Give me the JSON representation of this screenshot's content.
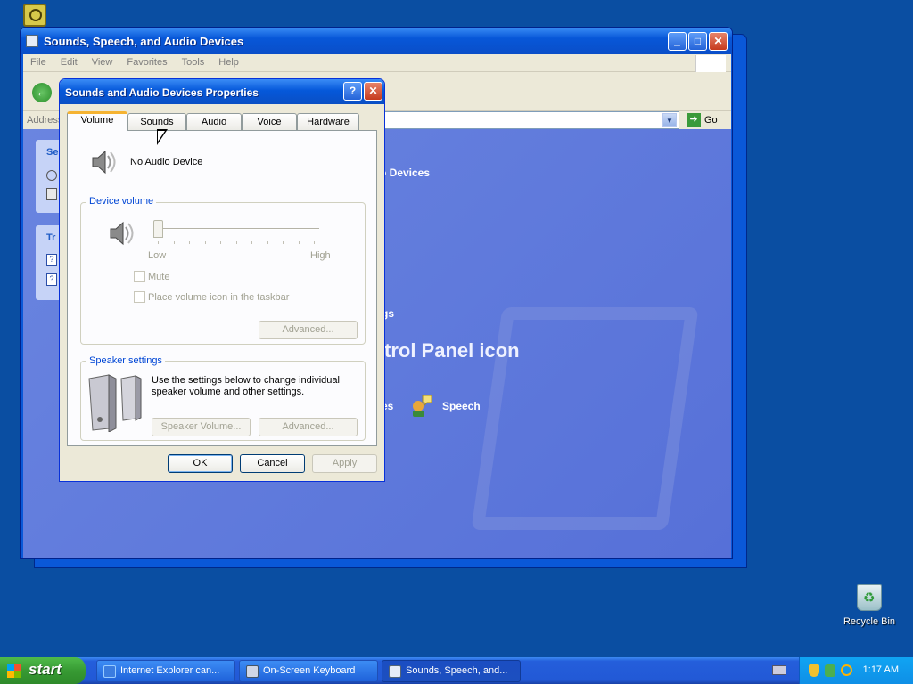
{
  "desktop": {
    "recycle_bin_label": "Recycle Bin"
  },
  "explorer": {
    "title": "Sounds, Speech, and Audio Devices",
    "menu": [
      "File",
      "Edit",
      "View",
      "Favorites",
      "Tools",
      "Help"
    ],
    "address_label": "Address",
    "go_label": "Go",
    "content_heading_partial": "o Devices",
    "pick_text_partial": "trol Panel icon",
    "partial_link_1": "gs",
    "partial_link_2": "es",
    "speech_label": "Speech",
    "task_pane_1_partial": "Se",
    "task_pane_2_partial": "Tr"
  },
  "dialog": {
    "title": "Sounds and Audio Devices Properties",
    "tabs": [
      "Volume",
      "Sounds",
      "Audio",
      "Voice",
      "Hardware"
    ],
    "active_tab": "Volume",
    "device_name": "No Audio Device",
    "device_volume_label": "Device volume",
    "volume_low": "Low",
    "volume_high": "High",
    "volume_level": 0,
    "mute_label": "Mute",
    "taskbar_icon_label": "Place volume icon in the taskbar",
    "advanced_label": "Advanced...",
    "speaker_settings_label": "Speaker settings",
    "speaker_desc": "Use the settings below to change individual speaker volume and other settings.",
    "speaker_volume_label": "Speaker Volume...",
    "speaker_advanced_label": "Advanced...",
    "ok": "OK",
    "cancel": "Cancel",
    "apply": "Apply"
  },
  "taskbar": {
    "start_label": "start",
    "buttons": [
      {
        "label": "Internet Explorer can...",
        "icon": "ie-icon"
      },
      {
        "label": "On-Screen Keyboard",
        "icon": "keyboard-icon"
      },
      {
        "label": "Sounds, Speech, and...",
        "icon": "control-panel-icon"
      }
    ],
    "clock": "1:17 AM"
  }
}
